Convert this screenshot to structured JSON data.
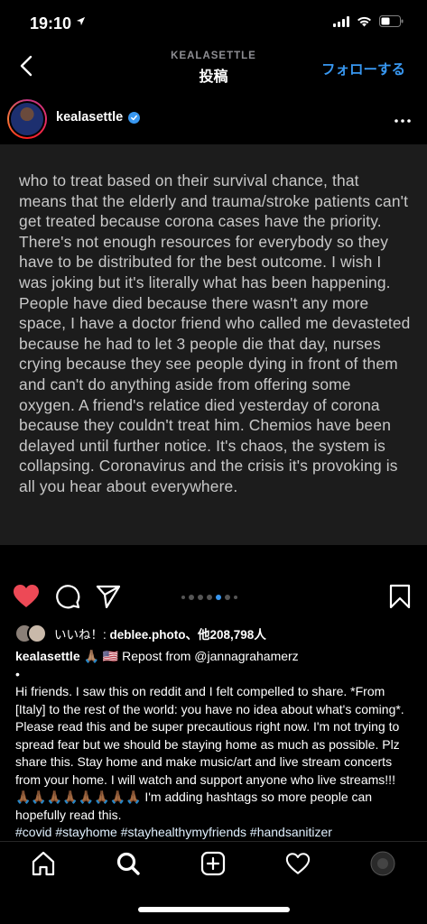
{
  "status_bar": {
    "time": "19:10",
    "location_arrow": "location-arrow-icon"
  },
  "nav": {
    "username": "KEALASETTLE",
    "title": "投稿",
    "follow_label": "フォローする"
  },
  "post": {
    "username": "kealasettle",
    "verified": true,
    "image_text": "who to treat based on their survival chance, that means that the elderly and trauma/stroke patients can't get treated because corona cases have the priority. There's not enough resources for everybody so they have to be distributed for the best outcome. I wish I was joking but it's literally what has been happening. People have died because there wasn't any more space, I have a doctor friend who called me devasteted because he had to let 3 people die that day, nurses crying because they see people dying in front of them and can't do anything aside from offering some oxygen. A friend's relatice died yesterday of corona because they couldn't treat him. Chemios have been delayed until further notice. It's chaos, the system is collapsing. Coronavirus and the crisis it's provoking is all you hear about everywhere."
  },
  "likes": {
    "prefix": "いいね！: ",
    "user": "deblee.photo",
    "suffix": "、他208,798人"
  },
  "caption": {
    "username": "kealasettle",
    "emoji_head": "🙏🏽 🇺🇸",
    "repost": " Repost from @jannagrahamerz",
    "bullet": "•",
    "body": "Hi friends. I saw this on reddit and I felt compelled to share. *From [Italy] to the rest of the world: you have no idea about what's coming*. Please read this and be super precautious right now. I'm not trying to spread fear but we should be staying home as much as possible. Plz share this. Stay home and make music/art and live stream concerts from your home. I will watch and support anyone who live streams!!! 🙏🏾🙏🏾🙏🏾🙏🏾🙏🏾🙏🏾🙏🏾🙏🏾 I'm adding hashtags so more people can hopefully read this.",
    "hashtags": "#covid #stayhome #stayhealthymyfriends #handsanitizer"
  },
  "carousel": {
    "count": 7,
    "active_index": 5
  },
  "colors": {
    "accent": "#3897f0",
    "like_red": "#ed4956",
    "background": "#000000",
    "image_bg": "#1c1c1c"
  },
  "icons": {
    "back": "chevron-left-icon",
    "more": "more-horizontal-icon",
    "like": "heart-filled-icon",
    "comment": "comment-icon",
    "share": "paper-plane-icon",
    "save": "bookmark-icon",
    "tabs": [
      "home-icon",
      "search-icon",
      "add-post-icon",
      "activity-heart-icon",
      "profile-avatar-icon"
    ]
  }
}
